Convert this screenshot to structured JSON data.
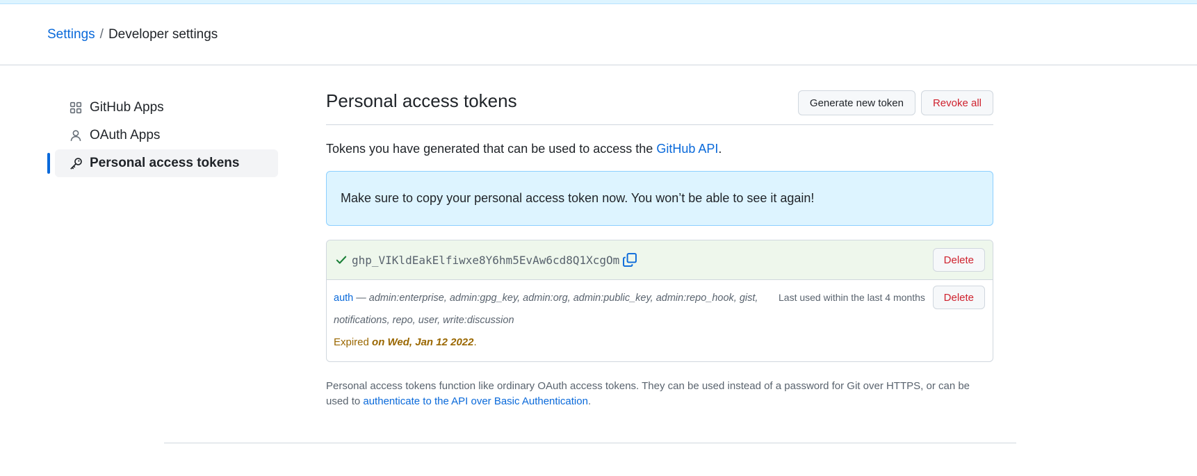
{
  "breadcrumb": {
    "root": "Settings",
    "separator": "/",
    "current": "Developer settings"
  },
  "sidebar": {
    "items": [
      {
        "label": "GitHub Apps",
        "icon": "apps-grid-icon"
      },
      {
        "label": "OAuth Apps",
        "icon": "person-icon"
      },
      {
        "label": "Personal access tokens",
        "icon": "key-icon",
        "active": true
      }
    ]
  },
  "main": {
    "title": "Personal access tokens",
    "generate_label": "Generate new token",
    "revoke_label": "Revoke all",
    "intro_text": "Tokens you have generated that can be used to access the ",
    "intro_link": "GitHub API",
    "intro_end": ".",
    "flash_message": "Make sure to copy your personal access token now. You won’t be able to see it again!"
  },
  "token": {
    "value": "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",
    "delete_label": "Delete",
    "name": "auth",
    "dash": " — ",
    "scopes": "admin:enterprise, admin:gpg_key, admin:org, admin:public_key, admin:repo_hook, gist, notifications, repo, user, write:discussion",
    "last_used": "Last used within the last 4 months",
    "expired_label": "Expired ",
    "expired_date": "on Wed, Jan 12 2022",
    "expired_end": "."
  },
  "footnote": {
    "text": "Personal access tokens function like ordinary OAuth access tokens. They can be used instead of a password for Git over HTTPS, or can be used to ",
    "link": "authenticate to the API over Basic Authentication",
    "end": "."
  },
  "colors": {
    "accent": "#0969da",
    "danger": "#cf222e",
    "success": "#1a7f37",
    "attention": "#9a6700",
    "flash_bg": "#ddf4ff",
    "token_bg": "#eef7ec"
  }
}
